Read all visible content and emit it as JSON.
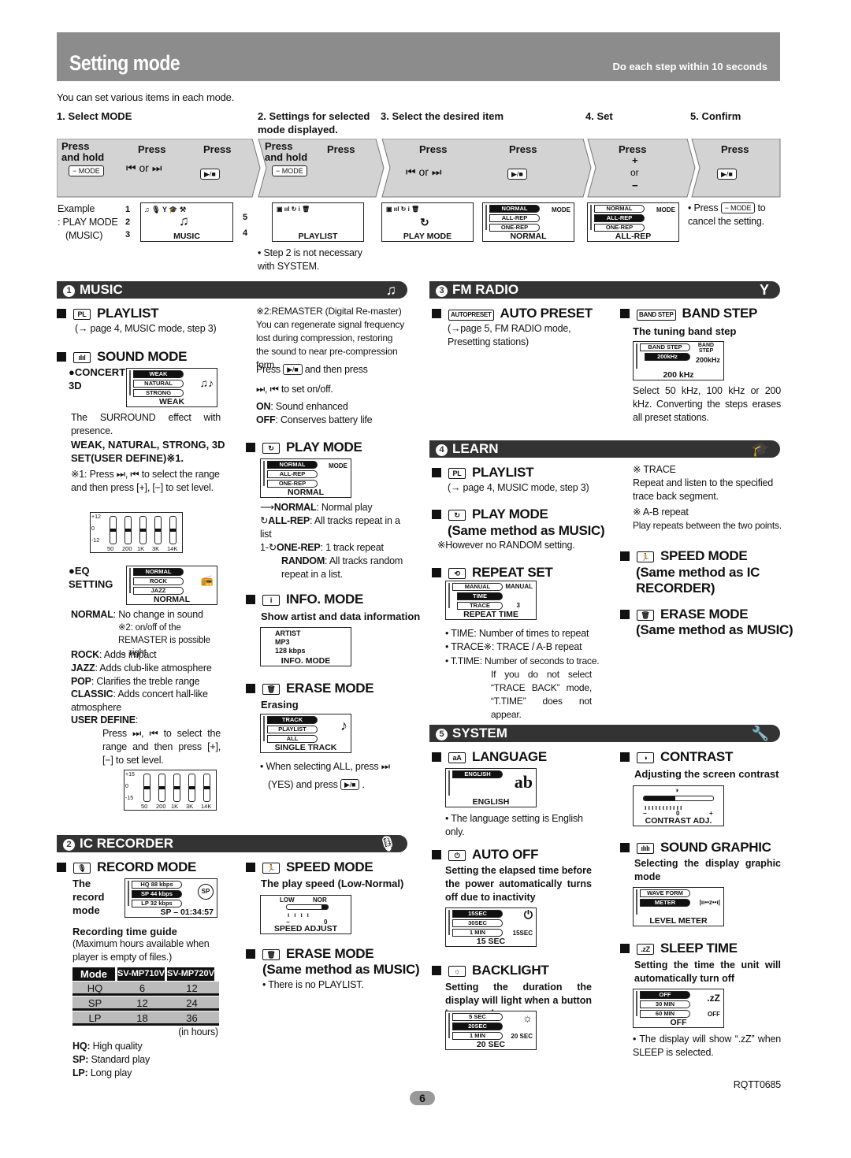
{
  "header": {
    "title": "Setting mode",
    "note": "Do each step within 10 seconds"
  },
  "intro": "You can set various items in each mode.",
  "steps": [
    "1. Select MODE",
    "2. Settings for selected mode displayed.",
    "3. Select the desired item",
    "4. Set",
    "5. Confirm"
  ],
  "band": {
    "press_hold": "Press and hold",
    "press": "Press",
    "or": "or",
    "mode_key": "− MODE",
    "play_key": "▶/■",
    "plus": "+",
    "minus": "−"
  },
  "example": {
    "label": "Example",
    "sub": ": PLAY MODE",
    "paren": "(MUSIC)",
    "callouts": [
      "1",
      "2",
      "3",
      "4",
      "5"
    ],
    "lcd_music": "MUSIC",
    "lcd_playlist": "PLAYLIST",
    "lcd_playmode": "PLAY MODE",
    "lcd_set": {
      "items": [
        "NORMAL",
        "ALL-REP",
        "ONE-REP"
      ],
      "tag": "MODE",
      "caption": "NORMAL"
    },
    "lcd_confirm": {
      "items": [
        "NORMAL",
        "ALL-REP",
        "ONE-REP"
      ],
      "tag": "MODE",
      "caption": "ALL-REP"
    }
  },
  "step2_note": "• Step 2 is not necessary with SYSTEM.",
  "confirm_note": {
    "pre": "• Press",
    "key": "− MODE",
    "post": "to cancel the setting."
  },
  "music": {
    "num": "1",
    "title": "MUSIC",
    "icon": "music-note",
    "playlist": {
      "title": "PLAYLIST",
      "sub": "(→ page 4, MUSIC mode, step 3)"
    },
    "sound": {
      "title": "SOUND MODE",
      "concert": "●CONCERT 3D",
      "lcd": {
        "items": [
          "WEAK",
          "NATURAL",
          "STRONG"
        ],
        "caption": "WEAK"
      },
      "desc": "The SURROUND effect with presence.",
      "options": "WEAK, NATURAL, STRONG, 3D SET(USER DEFINE)※1.",
      "note1": "※1: Press ⏭, ⏮ to select the range and then press [+], [−] to set level.",
      "eq1": {
        "levels": [
          "+12",
          "0",
          "-12"
        ],
        "bands": [
          "50",
          "200",
          "1K",
          "3K",
          "14K"
        ]
      },
      "eq": "●EQ SETTING",
      "eq_lcd": {
        "items": [
          "NORMAL",
          "ROCK",
          "JAZZ"
        ],
        "caption": "NORMAL"
      },
      "normal": {
        "k": "NORMAL",
        "v": ": No change in sound"
      },
      "note2": "※2: on/off of the REMASTER is possible → right",
      "rock": {
        "k": "ROCK",
        "v": ": Adds impact"
      },
      "jazz": {
        "k": "JAZZ",
        "v": ":  Adds club-like atmosphere"
      },
      "pop": {
        "k": "POP",
        "v": ":  Clarifies the treble range"
      },
      "classic": {
        "k": "CLASSIC",
        "v": ":  Adds concert hall-like atmosphere"
      },
      "user": {
        "k": "USER  DEFINE",
        "v": ":"
      },
      "user_text": "Press ⏭, ⏮ to select the range and then press [+], [−] to set level.",
      "eq2": {
        "levels": [
          "+15",
          "0",
          "-15"
        ],
        "bands": [
          "50",
          "200",
          "1K",
          "3K",
          "14K"
        ]
      }
    },
    "remaster": {
      "title": "※2:REMASTER (Digital Re-master)",
      "text": "You can regenerate signal frequency lost during compression, restoring the sound to near pre-compression form.",
      "press": "Press",
      "key": "▶/■",
      "then": "and then press",
      "onoff": "⏭, ⏮ to set on/off.",
      "on": {
        "k": "ON",
        "v": ":  Sound enhanced"
      },
      "off": {
        "k": "OFF",
        "v": ": Conserves battery life"
      }
    },
    "playmode": {
      "title": "PLAY MODE",
      "lcd": {
        "items": [
          "NORMAL",
          "ALL-REP",
          "ONE-REP"
        ],
        "tag": "MODE",
        "caption": "NORMAL"
      },
      "rows": [
        {
          "k": "NORMAL",
          "v": ": Normal play"
        },
        {
          "k": "ALL-REP",
          "v": ": All tracks repeat in a list"
        },
        {
          "k": "ONE-REP",
          "v": ": 1 track repeat"
        },
        {
          "k": "RANDOM",
          "v": ": All tracks random repeat in a list."
        }
      ]
    },
    "info": {
      "title": "INFO. MODE",
      "sub": "Show artist and data information",
      "lcd": {
        "lines": [
          "ARTIST",
          "MP3",
          "128 kbps"
        ],
        "caption": "INFO. MODE"
      }
    },
    "erase": {
      "title": "ERASE MODE",
      "sub": "Erasing",
      "lcd": {
        "items": [
          "TRACK",
          "PLAYLIST",
          "ALL"
        ],
        "caption": "SINGLE TRACK"
      },
      "note1": "• When selecting ALL, press ⏭",
      "note2": "(YES) and press",
      "key": "▶/■"
    }
  },
  "fm": {
    "num": "3",
    "title": "FM RADIO",
    "icon": "antenna",
    "auto": {
      "icon": "AUTOPRESET",
      "title": "AUTO PRESET",
      "sub": "(→page 5, FM RADIO mode, Presetting stations)"
    },
    "band": {
      "icon": "BAND STEP",
      "title": "BAND STEP",
      "sub": "The tuning band step",
      "lcd": {
        "items": [
          "BAND STEP",
          "200kHz"
        ],
        "tag": "BAND STEP",
        "val": "200kHz",
        "caption": "200  kHz"
      },
      "text": "Select 50 kHz, 100 kHz or 200 kHz. Converting the steps erases all preset stations."
    }
  },
  "learn": {
    "num": "4",
    "title": "LEARN",
    "icon": "graduation-cap",
    "playlist": {
      "title": "PLAYLIST",
      "sub": "(→ page 4, MUSIC mode, step 3)"
    },
    "playmode": {
      "title": "PLAY MODE",
      "same": "(Same method as MUSIC)",
      "note": "※However no RANDOM setting."
    },
    "repeat": {
      "title": "REPEAT SET",
      "lcd": {
        "items": [
          "MANUAL",
          "TIME",
          "TRACE"
        ],
        "tag": "MANUAL",
        "num": "3",
        "caption": "REPEAT  TIME"
      },
      "bullets": [
        "• TIME: Number of times to repeat",
        "• TRACE※: TRACE / A-B repeat",
        "• T.TIME: Number of seconds to trace."
      ],
      "tnote": "If you do not select “TRACE BACK” mode, “T.TIME” does not appear."
    },
    "trace": {
      "t1": "※ TRACE",
      "d1": "Repeat and listen to the specified trace back segment.",
      "t2": "※ A-B repeat",
      "d2": "Play repeats between the two points."
    },
    "speed": {
      "title": "SPEED MODE",
      "same": "(Same method as IC RECORDER)"
    },
    "erase": {
      "title": "ERASE MODE",
      "same": "(Same method as MUSIC)"
    }
  },
  "system": {
    "num": "5",
    "title": "SYSTEM",
    "icon": "wrench",
    "language": {
      "title": "LANGUAGE",
      "lcd": {
        "items": [
          "ENGLISH"
        ],
        "caption": "ENGLISH"
      },
      "note": "• The language setting is English only."
    },
    "autooff": {
      "title": "AUTO OFF",
      "sub": "Setting the elapsed time before the power automatically turns off due to inactivity",
      "lcd": {
        "items": [
          "15SEC",
          "30SEC",
          "1 MIN"
        ],
        "tag": "15SEC",
        "caption": "15  SEC"
      }
    },
    "backlight": {
      "title": "BACKLIGHT",
      "sub": "Setting the duration the display will light when a button is pressed",
      "lcd": {
        "items": [
          "5 SEC",
          "20SEC",
          "1 MIN"
        ],
        "tag": "20 SEC",
        "caption": "20  SEC"
      }
    },
    "contrast": {
      "title": "CONTRAST",
      "sub": "Adjusting the screen contrast",
      "lcd": {
        "minus": "−",
        "zero": "0",
        "plus": "+",
        "caption": "CONTRAST ADJ.",
        "level": 0.45
      }
    },
    "graphic": {
      "title": "SOUND GRAPHIC",
      "sub": "Selecting the display graphic mode",
      "lcd": {
        "items": [
          "WAVE FORM",
          "METER"
        ],
        "caption": "LEVEL METER"
      }
    },
    "sleep": {
      "title": "SLEEP TIME",
      "sub": "Setting the time the unit will automatically turn off",
      "lcd": {
        "items": [
          "OFF",
          "30 MIN",
          "60 MIN"
        ],
        "tag": ".zZ",
        "tag2": "OFF",
        "caption": "OFF"
      },
      "note": "• The display will show “.zZ” when SLEEP is selected."
    }
  },
  "ic": {
    "num": "2",
    "title": "IC RECORDER",
    "icon": "microphone",
    "record": {
      "title": "RECORD MODE",
      "sub": "The record mode",
      "lcd": {
        "items": [
          "HQ 88 kbps",
          "SP 44 kbps",
          "LP 32 kbps"
        ],
        "tag": "SP",
        "caption": "SP   – 01:34:57"
      },
      "guide": "Recording time guide",
      "guide_sub": "(Maximum hours available when player is empty of files.)",
      "table": {
        "headers": [
          "Mode",
          "SV-MP710V",
          "SV-MP720V"
        ],
        "rows": [
          [
            "HQ",
            "6",
            "12"
          ],
          [
            "SP",
            "12",
            "24"
          ],
          [
            "LP",
            "18",
            "36"
          ]
        ]
      },
      "unit": "(in hours)",
      "hq": {
        "k": "HQ:",
        "v": " High quality"
      },
      "sp": {
        "k": "SP:",
        "v": " Standard play"
      },
      "lp": {
        "k": "LP:",
        "v": " Long play"
      }
    },
    "speed": {
      "title": "SPEED MODE",
      "sub": "The play speed (Low-Normal)",
      "lcd": {
        "low": "LOW",
        "nor": "NOR",
        "minus": "−",
        "zero": "0",
        "caption": "SPEED  ADJUST",
        "level": 1.0
      }
    },
    "erase": {
      "title": "ERASE MODE",
      "same": "(Same method as MUSIC)",
      "note": "• There is no PLAYLIST."
    }
  },
  "footer": {
    "page": "6",
    "code": "RQTT0685"
  }
}
